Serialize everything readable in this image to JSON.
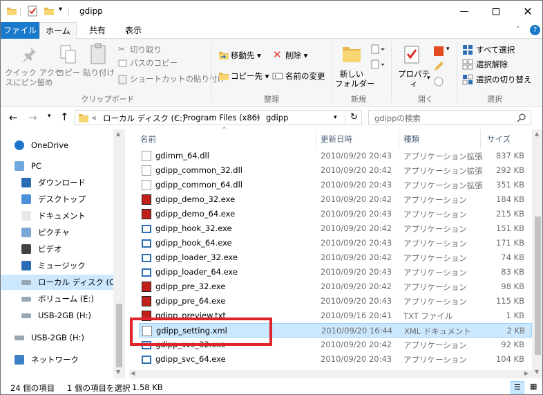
{
  "window": {
    "title": "gdipp"
  },
  "tabs": [
    "ファイル",
    "ホーム",
    "共有",
    "表示"
  ],
  "ribbon": {
    "clipboard": {
      "pin": "クイック アクセ\nスにピン留め",
      "copy": "コピー",
      "paste": "貼り付け",
      "cut": "切り取り",
      "copy_path": "パスのコピー",
      "paste_shortcut": "ショートカットの貼り付け",
      "label": "クリップボード"
    },
    "organize": {
      "move_to": "移動先",
      "copy_to": "コピー先",
      "delete": "削除",
      "rename": "名前の変更",
      "label": "整理"
    },
    "new": {
      "new_folder": "新しい\nフォルダー",
      "label": "新規"
    },
    "open": {
      "properties": "プロパティ",
      "label": "開く"
    },
    "select": {
      "select_all": "すべて選択",
      "select_none": "選択解除",
      "invert": "選択の切り替え",
      "label": "選択"
    }
  },
  "address": {
    "overflow": "«",
    "crumbs": [
      "ローカル ディスク (C:)",
      "Program Files (x86)",
      "gdipp"
    ],
    "search_placeholder": "gdippの検索"
  },
  "nav": [
    {
      "label": "OneDrive",
      "icon": "onedrive-icon"
    },
    {
      "label": "PC",
      "icon": "pc-icon"
    },
    {
      "label": "ダウンロード",
      "icon": "download-icon"
    },
    {
      "label": "デスクトップ",
      "icon": "desktop-icon"
    },
    {
      "label": "ドキュメント",
      "icon": "document-icon"
    },
    {
      "label": "ピクチャ",
      "icon": "picture-icon"
    },
    {
      "label": "ビデオ",
      "icon": "video-icon"
    },
    {
      "label": "ミュージック",
      "icon": "music-icon"
    },
    {
      "label": "ローカル ディスク (C:)",
      "icon": "drive-icon"
    },
    {
      "label": "ボリューム (E:)",
      "icon": "drive-icon"
    },
    {
      "label": "USB-2GB (H:)",
      "icon": "usb-drive-icon"
    },
    {
      "label": "USB-2GB (H:)",
      "icon": "usb-drive-icon"
    },
    {
      "label": "ネットワーク",
      "icon": "network-icon"
    }
  ],
  "columns": {
    "name": "名前",
    "date": "更新日時",
    "type": "種類",
    "size": "サイズ"
  },
  "files": [
    {
      "name": "gdimm_64.dll",
      "date": "2010/09/20 20:43",
      "type": "アプリケーション拡張",
      "size": "837 KB",
      "icon": "dll"
    },
    {
      "name": "gdipp_common_32.dll",
      "date": "2010/09/20 20:42",
      "type": "アプリケーション拡張",
      "size": "292 KB",
      "icon": "dll"
    },
    {
      "name": "gdipp_common_64.dll",
      "date": "2010/09/20 20:43",
      "type": "アプリケーション拡張",
      "size": "351 KB",
      "icon": "dll"
    },
    {
      "name": "gdipp_demo_32.exe",
      "date": "2010/09/20 20:42",
      "type": "アプリケーション",
      "size": "184 KB",
      "icon": "app"
    },
    {
      "name": "gdipp_demo_64.exe",
      "date": "2010/09/20 20:43",
      "type": "アプリケーション",
      "size": "215 KB",
      "icon": "app"
    },
    {
      "name": "gdipp_hook_32.exe",
      "date": "2010/09/20 20:42",
      "type": "アプリケーション",
      "size": "151 KB",
      "icon": "exe"
    },
    {
      "name": "gdipp_hook_64.exe",
      "date": "2010/09/20 20:43",
      "type": "アプリケーション",
      "size": "171 KB",
      "icon": "exe"
    },
    {
      "name": "gdipp_loader_32.exe",
      "date": "2010/09/20 20:42",
      "type": "アプリケーション",
      "size": "74 KB",
      "icon": "exe"
    },
    {
      "name": "gdipp_loader_64.exe",
      "date": "2010/09/20 20:43",
      "type": "アプリケーション",
      "size": "83 KB",
      "icon": "exe"
    },
    {
      "name": "gdipp_pre_32.exe",
      "date": "2010/09/20 20:42",
      "type": "アプリケーション",
      "size": "98 KB",
      "icon": "app"
    },
    {
      "name": "gdipp_pre_64.exe",
      "date": "2010/09/20 20:43",
      "type": "アプリケーション",
      "size": "115 KB",
      "icon": "app"
    },
    {
      "name": "gdipp_preview.txt",
      "date": "2010/09/16 20:41",
      "type": "TXT ファイル",
      "size": "1 KB",
      "icon": "app"
    },
    {
      "name": "gdipp_setting.xml",
      "date": "2010/09/20 16:44",
      "type": "XML ドキュメント",
      "size": "2 KB",
      "icon": "xml",
      "selected": true
    },
    {
      "name": "gdipp_svc_32.exe",
      "date": "2010/09/20 20:42",
      "type": "アプリケーション",
      "size": "92 KB",
      "icon": "exe"
    },
    {
      "name": "gdipp_svc_64.exe",
      "date": "2010/09/20 20:43",
      "type": "アプリケーション",
      "size": "104 KB",
      "icon": "exe"
    }
  ],
  "status": {
    "count": "24 個の項目",
    "selection": "1 個の項目を選択",
    "size": "1.58 KB"
  },
  "colors": {
    "accent": "#1979ca",
    "selection": "#cce8ff",
    "highlight_box": "#e0242b"
  }
}
